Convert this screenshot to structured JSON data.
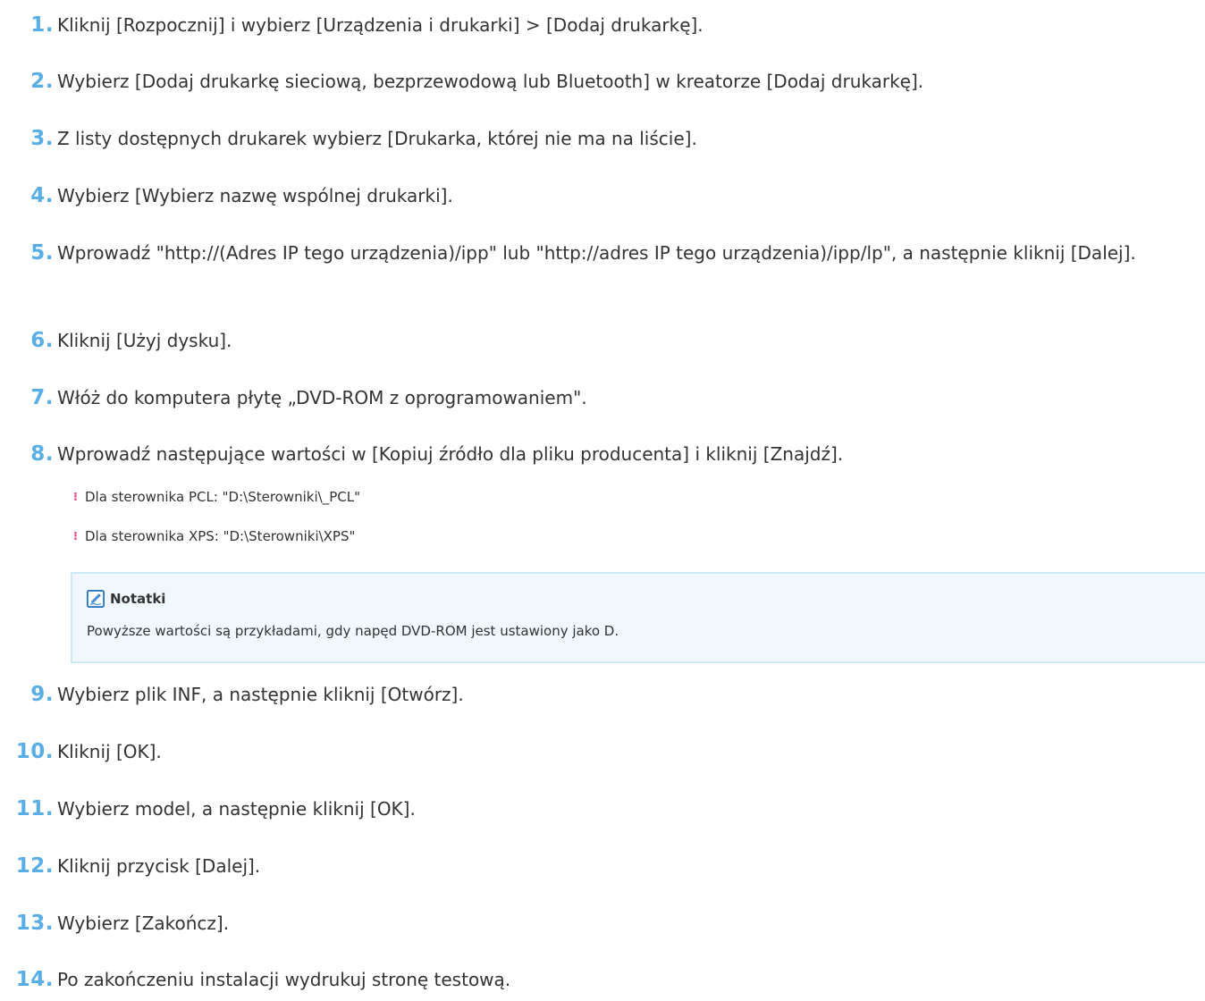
{
  "steps": [
    {
      "num": "1.",
      "text": "Kliknij [Rozpocznij] i wybierz [Urządzenia i drukarki] > [Dodaj drukarkę]."
    },
    {
      "num": "2.",
      "text": "Wybierz [Dodaj drukarkę sieciową, bezprzewodową lub Bluetooth] w kreatorze [Dodaj drukarkę]."
    },
    {
      "num": "3.",
      "text": "Z listy dostępnych drukarek wybierz [Drukarka, której nie ma na liście]."
    },
    {
      "num": "4.",
      "text": "Wybierz [Wybierz nazwę wspólnej drukarki]."
    },
    {
      "num": "5.",
      "text": "Wprowadź \"http://(Adres IP tego urządzenia)/ipp\" lub \"http://adres IP tego urządzenia)/ipp/lp\", a następnie kliknij [Dalej]."
    },
    {
      "num": "6.",
      "text": "Kliknij [Użyj dysku]."
    },
    {
      "num": "7.",
      "text": "Włóż do komputera płytę „DVD-ROM z oprogramowaniem\"."
    },
    {
      "num": "8.",
      "text": "Wprowadź następujące wartości w [Kopiuj źródło dla pliku producenta] i kliknij [Znajdź]."
    },
    {
      "num": "9.",
      "text": "Wybierz plik INF, a następnie kliknij [Otwórz]."
    },
    {
      "num": "10.",
      "text": "Kliknij [OK]."
    },
    {
      "num": "11.",
      "text": "Wybierz model, a następnie kliknij [OK]."
    },
    {
      "num": "12.",
      "text": "Kliknij przycisk [Dalej]."
    },
    {
      "num": "13.",
      "text": "Wybierz [Zakończ]."
    },
    {
      "num": "14.",
      "text": "Po zakończeniu instalacji wydrukuj stronę testową."
    }
  ],
  "bullets": [
    "Dla sterownika PCL: \"D:\\Sterowniki\\_PCL\"",
    "Dla sterownika XPS: \"D:\\Sterowniki\\XPS\""
  ],
  "note": {
    "title": "Notatki",
    "body": "Powyższe wartości są przykładami, gdy napęd DVD-ROM jest ustawiony jako D.",
    "icon": "pencil-note-icon"
  },
  "colors": {
    "step_number": "#5aaee6",
    "bullet": "#e0457b",
    "note_bg": "#f0f8fd",
    "note_border": "#cde9f6"
  }
}
